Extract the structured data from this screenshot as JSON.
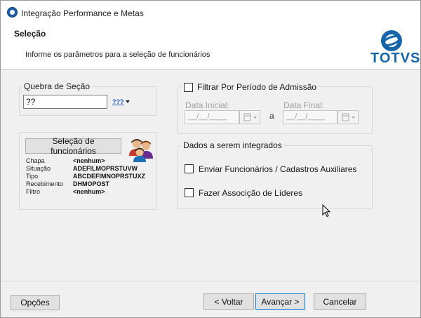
{
  "window": {
    "title": "Integração Performance e Metas",
    "colors": {
      "accent": "#1565a8",
      "background": "#f0f0f0"
    }
  },
  "header": {
    "title": "Seleção",
    "subtitle": "Informe os parâmetros para a seleção de funcionários",
    "logo_text": "TOTVS"
  },
  "quebra": {
    "legend": "Quebra de Seção",
    "value": "??",
    "lookup_icon_text": "???"
  },
  "selecao": {
    "button_label": "Seleção de funcionários",
    "rows": [
      {
        "key": "Chapa",
        "value": "<nenhum>"
      },
      {
        "key": "Situação",
        "value": "ADEFILMOPRSTUVW"
      },
      {
        "key": "Tipo",
        "value": "ABCDEFIMNOPRSTUXZ"
      },
      {
        "key": "Recebimento",
        "value": "DHMOPOST"
      },
      {
        "key": "Filtro",
        "value": "<nenhum>"
      }
    ]
  },
  "periodo": {
    "checkbox_label": "Filtrar Por Período de Admissão",
    "checked": false,
    "data_inicial_label": "Data Inicial:",
    "data_final_label": "Data Final:",
    "date_placeholder": "__/__/____",
    "separator": "a"
  },
  "dados": {
    "legend": "Dados a serem integrados",
    "options": [
      {
        "label": "Enviar Funcionários / Cadastros Auxiliares",
        "checked": false
      },
      {
        "label": "Fazer Associção de Líderes",
        "checked": false
      }
    ]
  },
  "footer": {
    "opcoes": "Opções",
    "voltar": "< Voltar",
    "avancar": "Avançar >",
    "cancelar": "Cancelar"
  }
}
